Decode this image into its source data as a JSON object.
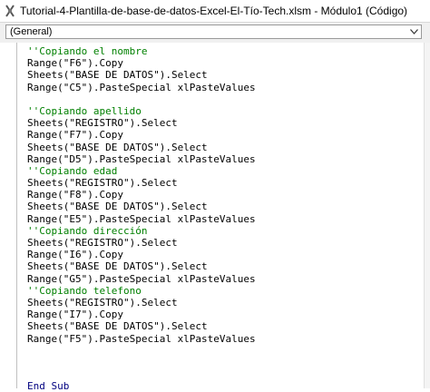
{
  "window": {
    "title": "Tutorial-4-Plantilla-de-base-de-datos-Excel-El-Tío-Tech.xlsm - Módulo1 (Código)",
    "icon": "vba-module-icon"
  },
  "toolbar": {
    "object_dropdown": "(General)"
  },
  "code": {
    "lines": [
      {
        "text": "''Copiando el nombre",
        "kind": "comment"
      },
      {
        "text": "Range(\"F6\").Copy",
        "kind": "code"
      },
      {
        "text": "Sheets(\"BASE DE DATOS\").Select",
        "kind": "code"
      },
      {
        "text": "Range(\"C5\").PasteSpecial xlPasteValues",
        "kind": "code"
      },
      {
        "text": "",
        "kind": "blank"
      },
      {
        "text": "''Copiando apellido",
        "kind": "comment"
      },
      {
        "text": "Sheets(\"REGISTRO\").Select",
        "kind": "code"
      },
      {
        "text": "Range(\"F7\").Copy",
        "kind": "code"
      },
      {
        "text": "Sheets(\"BASE DE DATOS\").Select",
        "kind": "code"
      },
      {
        "text": "Range(\"D5\").PasteSpecial xlPasteValues",
        "kind": "code"
      },
      {
        "text": "''Copiando edad",
        "kind": "comment"
      },
      {
        "text": "Sheets(\"REGISTRO\").Select",
        "kind": "code"
      },
      {
        "text": "Range(\"F8\").Copy",
        "kind": "code"
      },
      {
        "text": "Sheets(\"BASE DE DATOS\").Select",
        "kind": "code"
      },
      {
        "text": "Range(\"E5\").PasteSpecial xlPasteValues",
        "kind": "code"
      },
      {
        "text": "''Copiando dirección",
        "kind": "comment"
      },
      {
        "text": "Sheets(\"REGISTRO\").Select",
        "kind": "code"
      },
      {
        "text": "Range(\"I6\").Copy",
        "kind": "code"
      },
      {
        "text": "Sheets(\"BASE DE DATOS\").Select",
        "kind": "code"
      },
      {
        "text": "Range(\"G5\").PasteSpecial xlPasteValues",
        "kind": "code"
      },
      {
        "text": "''Copiando telefono",
        "kind": "comment"
      },
      {
        "text": "Sheets(\"REGISTRO\").Select",
        "kind": "code"
      },
      {
        "text": "Range(\"I7\").Copy",
        "kind": "code"
      },
      {
        "text": "Sheets(\"BASE DE DATOS\").Select",
        "kind": "code"
      },
      {
        "text": "Range(\"F5\").PasteSpecial xlPasteValues",
        "kind": "code"
      },
      {
        "text": "",
        "kind": "blank"
      },
      {
        "text": "",
        "kind": "blank"
      },
      {
        "text": "",
        "kind": "blank"
      },
      {
        "text": "End Sub",
        "kind": "keyword"
      }
    ]
  },
  "colors": {
    "comment": "#008000",
    "keyword": "#000080",
    "text": "#000000",
    "background": "#ffffff"
  }
}
